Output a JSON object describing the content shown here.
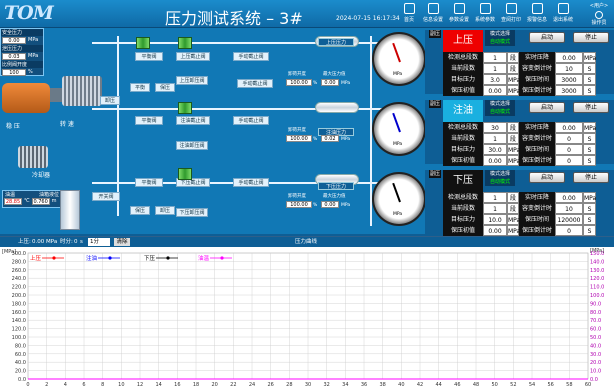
{
  "header": {
    "logo": "TOM",
    "title": "压力测试系统 – 3#",
    "datetime": "2024-07-15 16:17:34",
    "toolbar": [
      {
        "label": "首页",
        "icon": "home-icon"
      },
      {
        "label": "信息设置",
        "icon": "info-settings-icon"
      },
      {
        "label": "参数设置",
        "icon": "parameter-settings-icon"
      },
      {
        "label": "系统参数",
        "icon": "system-params-icon"
      },
      {
        "label": "查阅打印",
        "icon": "print-icon"
      },
      {
        "label": "报警信息",
        "icon": "alarm-icon"
      },
      {
        "label": "退出系统",
        "icon": "exit-icon"
      }
    ],
    "user": "<用户>",
    "user_role": "操作员"
  },
  "status": {
    "safety_label": "安全压力",
    "safety_value": "0.00",
    "safety_unit": "MPa",
    "loss_label": "泄压压力",
    "loss_value": "0.03",
    "loss_unit": "MPa",
    "ratio_label": "比例阀开度",
    "ratio_value": "100",
    "ratio_unit": "%",
    "rot_label": "稳 压",
    "rot2": "转 速",
    "temp_label": "油温",
    "temp_value": "28.85",
    "temp_unit": "℃",
    "level_label": "油箱液位",
    "level_value": "0.760",
    "level_unit": "m",
    "cooler": "冷却器"
  },
  "valves": {
    "upper_return": "平衡阀",
    "upper_stop": "上压截止阀",
    "manual1": "手动截止阀",
    "unload1": "上压卸压阀",
    "manual_valve": "手动截止阀",
    "ratio1": "卸荷开度",
    "max1": "最大压力值",
    "bal": "平衡",
    "guard": "保压",
    "unload_left": "卸压",
    "inject_return": "平衡阀",
    "inject_stop": "注油截止阀",
    "manual2": "手动截止阀",
    "unload2": "注油卸压阀",
    "ratio2": "卸荷开度",
    "max2": "注油压力",
    "lower_return": "平衡阀",
    "lower_stop": "下压截止阀",
    "manual3": "手动截止阀",
    "unload3": "下压卸压阀",
    "ratio3": "卸荷开度",
    "max3": "最大压力值",
    "guard3": "保压",
    "unload3b": "卸压",
    "bal3": "平衡",
    "oil_valve": "开关阀"
  },
  "tanks": [
    {
      "name": "上压压力",
      "ratio": "100.00",
      "unit": "%",
      "max": "0.00",
      "munit": "MPa"
    },
    {
      "name": "注油压力",
      "ratio": "100.00",
      "unit": "%",
      "max": "0.02",
      "munit": "MPa"
    },
    {
      "name": "下压压力",
      "ratio": "100.00",
      "unit": "%",
      "max": "0.00",
      "munit": "MPa"
    }
  ],
  "gauge_unit": "MPa",
  "panels": [
    {
      "mode_tag": "副压",
      "title": "上压",
      "mode": "模式选择",
      "mode_val": "自动模式",
      "start": "启动",
      "stop": "停止",
      "rows": [
        [
          "检测总段数",
          "1",
          "段",
          "实时压降",
          "0.00",
          "MPa"
        ],
        [
          "当前段数",
          "1",
          "段",
          "容变倒计时",
          "10",
          "S"
        ],
        [
          "目标压力",
          "3.0",
          "MPa",
          "保压时间",
          "3000",
          "S"
        ],
        [
          "保压初值",
          "0.00",
          "MPa",
          "保压倒计时",
          "3000",
          "S"
        ]
      ]
    },
    {
      "mode_tag": "副压",
      "title": "注油",
      "mode": "模式选择",
      "mode_val": "自动模式",
      "start": "启动",
      "stop": "停止",
      "rows": [
        [
          "检测总段数",
          "30",
          "段",
          "实时压降",
          "0.00",
          "MPa"
        ],
        [
          "当前段数",
          "1",
          "段",
          "容变倒计时",
          "0",
          "S"
        ],
        [
          "目标压力",
          "30.0",
          "MPa",
          "保压时间",
          "0",
          "S"
        ],
        [
          "保压初值",
          "0.00",
          "MPa",
          "保压倒计时",
          "0",
          "S"
        ]
      ]
    },
    {
      "mode_tag": "副压",
      "title": "下压",
      "mode": "模式选择",
      "mode_val": "自动模式",
      "start": "启动",
      "stop": "停止",
      "rows": [
        [
          "检测总段数",
          "1",
          "段",
          "实时压降",
          "0.00",
          "MPa"
        ],
        [
          "当前段数",
          "1",
          "段",
          "容变倒计时",
          "10",
          "S"
        ],
        [
          "目标压力",
          "10.0",
          "MPa",
          "保压时间",
          "120000",
          "S"
        ],
        [
          "保压初值",
          "0.00",
          "MPa",
          "保压倒计时",
          "0",
          "S"
        ]
      ]
    }
  ],
  "chart_bar": {
    "label1": "上压:",
    "val1": "0.00",
    "unit1": "MPa",
    "label2": "时分:",
    "val2": "0",
    "unit2": "s",
    "select": "1分",
    "clear": "清除",
    "title": "压力曲线",
    "right": "[MPa]"
  },
  "chart_data": {
    "type": "line",
    "title": "压力曲线",
    "ylabel": "[MPa]",
    "ylim": [
      0,
      300
    ],
    "y2lim": [
      0,
      150
    ],
    "xlim": [
      0,
      60
    ],
    "yticks": [
      "300.0",
      "280.0",
      "260.0",
      "240.0",
      "220.0",
      "200.0",
      "180.0",
      "160.0",
      "140.0",
      "120.0",
      "100.0",
      "80.0",
      "60.0",
      "40.0",
      "20.0",
      "0.0"
    ],
    "y2ticks": [
      "150.0",
      "140.0",
      "130.0",
      "120.0",
      "110.0",
      "100.0",
      "90.0",
      "80.0",
      "70.0",
      "60.0",
      "50.0",
      "40.0",
      "30.0",
      "20.0",
      "10.0",
      "0.0"
    ],
    "xticks": [
      "0",
      "2",
      "4",
      "6",
      "8",
      "10",
      "12",
      "14",
      "16",
      "18",
      "20",
      "22",
      "24",
      "26",
      "28",
      "30",
      "32",
      "34",
      "36",
      "38",
      "40",
      "42",
      "44",
      "46",
      "48",
      "50",
      "52",
      "54",
      "56",
      "58",
      "60"
    ],
    "series": [
      {
        "name": "上压",
        "color": "#ff0000",
        "values": []
      },
      {
        "name": "注油",
        "color": "#0000ff",
        "values": []
      },
      {
        "name": "下压",
        "color": "#000000",
        "values": []
      },
      {
        "name": "油温",
        "color": "#ff00ff",
        "values": []
      }
    ]
  }
}
